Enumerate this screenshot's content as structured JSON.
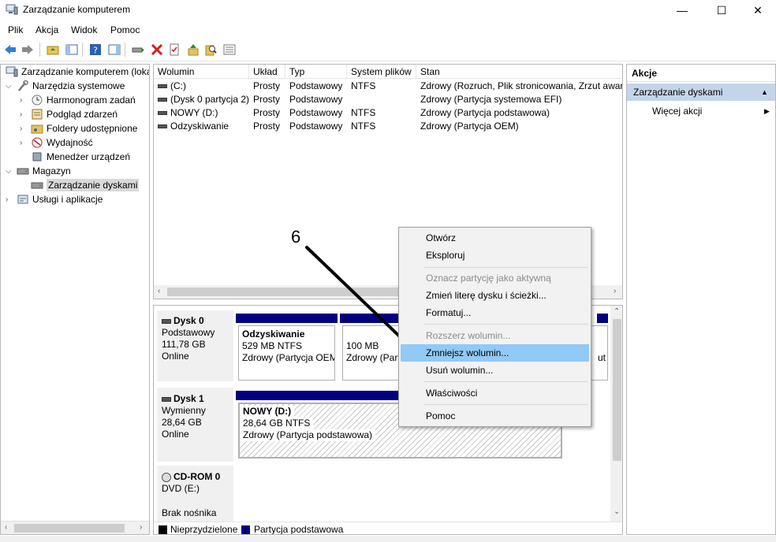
{
  "window": {
    "title": "Zarządzanie komputerem",
    "controls": {
      "minimize": "—",
      "maximize": "☐",
      "close": "✕"
    }
  },
  "menubar": [
    "Plik",
    "Akcja",
    "Widok",
    "Pomoc"
  ],
  "toolbar_icons": [
    "back-arrow-icon",
    "forward-arrow-icon",
    "up-folder-icon",
    "show-hide-tree-icon",
    "help-icon",
    "show-hide-action-pane-icon",
    "connect-icon",
    "delete-icon",
    "properties-icon",
    "upload-icon",
    "search-icon",
    "list-view-icon"
  ],
  "tree": {
    "items": [
      {
        "label": "Zarządzanie komputerem (loka",
        "icon": "computer-management-icon"
      },
      {
        "label": "Narzędzia systemowe",
        "icon": "tools-icon"
      },
      {
        "label": "Harmonogram zadań",
        "icon": "clock-icon"
      },
      {
        "label": "Podgląd zdarzeń",
        "icon": "event-viewer-icon"
      },
      {
        "label": "Foldery udostępnione",
        "icon": "shared-folder-icon"
      },
      {
        "label": "Wydajność",
        "icon": "performance-icon"
      },
      {
        "label": "Menedżer urządzeń",
        "icon": "device-manager-icon"
      },
      {
        "label": "Magazyn",
        "icon": "storage-icon"
      },
      {
        "label": "Zarządzanie dyskami",
        "icon": "disk-management-icon"
      },
      {
        "label": "Usługi i aplikacje",
        "icon": "services-icon"
      }
    ]
  },
  "volumes": {
    "columns": [
      "Wolumin",
      "Układ",
      "Typ",
      "System plików",
      "Stan"
    ],
    "rows": [
      [
        "(C:)",
        "Prosty",
        "Podstawowy",
        "NTFS",
        "Zdrowy (Rozruch, Plik stronicowania, Zrzut awar"
      ],
      [
        "(Dysk 0 partycja 2)",
        "Prosty",
        "Podstawowy",
        "",
        "Zdrowy (Partycja systemowa EFI)"
      ],
      [
        "NOWY (D:)",
        "Prosty",
        "Podstawowy",
        "NTFS",
        "Zdrowy (Partycja podstawowa)"
      ],
      [
        "Odzyskiwanie",
        "Prosty",
        "Podstawowy",
        "NTFS",
        "Zdrowy (Partycja OEM)"
      ]
    ]
  },
  "disks": [
    {
      "name": "Dysk 0",
      "type": "Podstawowy",
      "size": "111,78 GB",
      "status": "Online",
      "partitions": [
        {
          "name": "Odzyskiwanie",
          "size": "529 MB NTFS",
          "status": "Zdrowy (Partycja OEM"
        },
        {
          "name": "",
          "size": "100 MB",
          "status": "Zdrowy (Part"
        },
        {
          "name": "",
          "size": "",
          "status": "ut"
        }
      ]
    },
    {
      "name": "Dysk 1",
      "type": "Wymienny",
      "size": "28,64 GB",
      "status": "Online",
      "partitions": [
        {
          "name": "NOWY  (D:)",
          "size": "28,64 GB NTFS",
          "status": "Zdrowy (Partycja podstawowa)"
        }
      ]
    },
    {
      "name": "CD-ROM 0",
      "type": "DVD (E:)",
      "status": "Brak nośnika"
    }
  ],
  "legend": {
    "unallocated": "Nieprzydzielone",
    "primary": "Partycja podstawowa",
    "unallocated_color": "#000000",
    "primary_color": "#000080"
  },
  "actions": {
    "title": "Akcje",
    "section": "Zarządzanie dyskami",
    "more": "Więcej akcji"
  },
  "context_menu": {
    "items": [
      {
        "label": "Otwórz",
        "enabled": true
      },
      {
        "label": "Eksploruj",
        "enabled": true
      },
      {
        "label": "Oznacz partycję jako aktywną",
        "enabled": false
      },
      {
        "label": "Zmień literę dysku i ścieżki...",
        "enabled": true
      },
      {
        "label": "Formatuj...",
        "enabled": true
      },
      {
        "label": "Rozszerz wolumin...",
        "enabled": false
      },
      {
        "label": "Zmniejsz wolumin...",
        "enabled": true,
        "highlighted": true
      },
      {
        "label": "Usuń wolumin...",
        "enabled": true
      },
      {
        "label": "Właściwości",
        "enabled": true
      },
      {
        "label": "Pomoc",
        "enabled": true
      }
    ],
    "highlight_color": "#91c9f7"
  },
  "annotation": {
    "number": "6"
  }
}
